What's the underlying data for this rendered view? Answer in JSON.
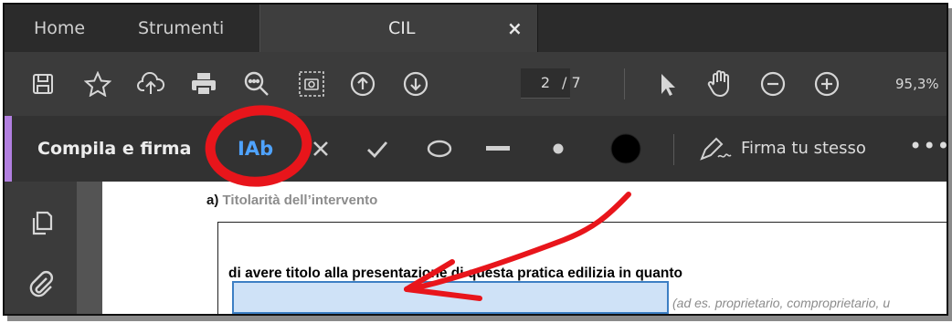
{
  "tabs": {
    "home": "Home",
    "tools": "Strumenti",
    "document": "CIL",
    "close_glyph": "×"
  },
  "toolbar": {
    "icons": [
      "save-icon",
      "star-icon",
      "cloud-upload-icon",
      "print-icon",
      "zoom-search-icon",
      "snapshot-icon",
      "prev-page-icon",
      "next-page-icon",
      "select-arrow-icon",
      "hand-icon",
      "zoom-out-icon",
      "zoom-in-icon"
    ],
    "current_page": "2",
    "total_pages": "/ 7",
    "zoom": "95,3%"
  },
  "fill_sign": {
    "title": "Compila e firma",
    "text_tool": "IAb",
    "tools": [
      "cross-mark-icon",
      "check-mark-icon",
      "ellipse-icon",
      "line-icon",
      "dot-icon",
      "color-swatch-icon"
    ],
    "sign_label": "Firma tu stesso",
    "more": "•••",
    "accent_color": "#b27fe0"
  },
  "side_rail": {
    "icons": [
      "copy-pages-icon",
      "paperclip-icon"
    ]
  },
  "document": {
    "section_prefix": "a)",
    "section_title": "Titolarità dell’intervento",
    "declaration": "di avere titolo alla presentazione di questa pratica edilizia in quanto",
    "field_value": "",
    "field_hint": "(ad es. proprietario, comproprietario, u"
  },
  "annotation_colors": {
    "circle": "#e8151b",
    "arrow": "#e8151b"
  }
}
